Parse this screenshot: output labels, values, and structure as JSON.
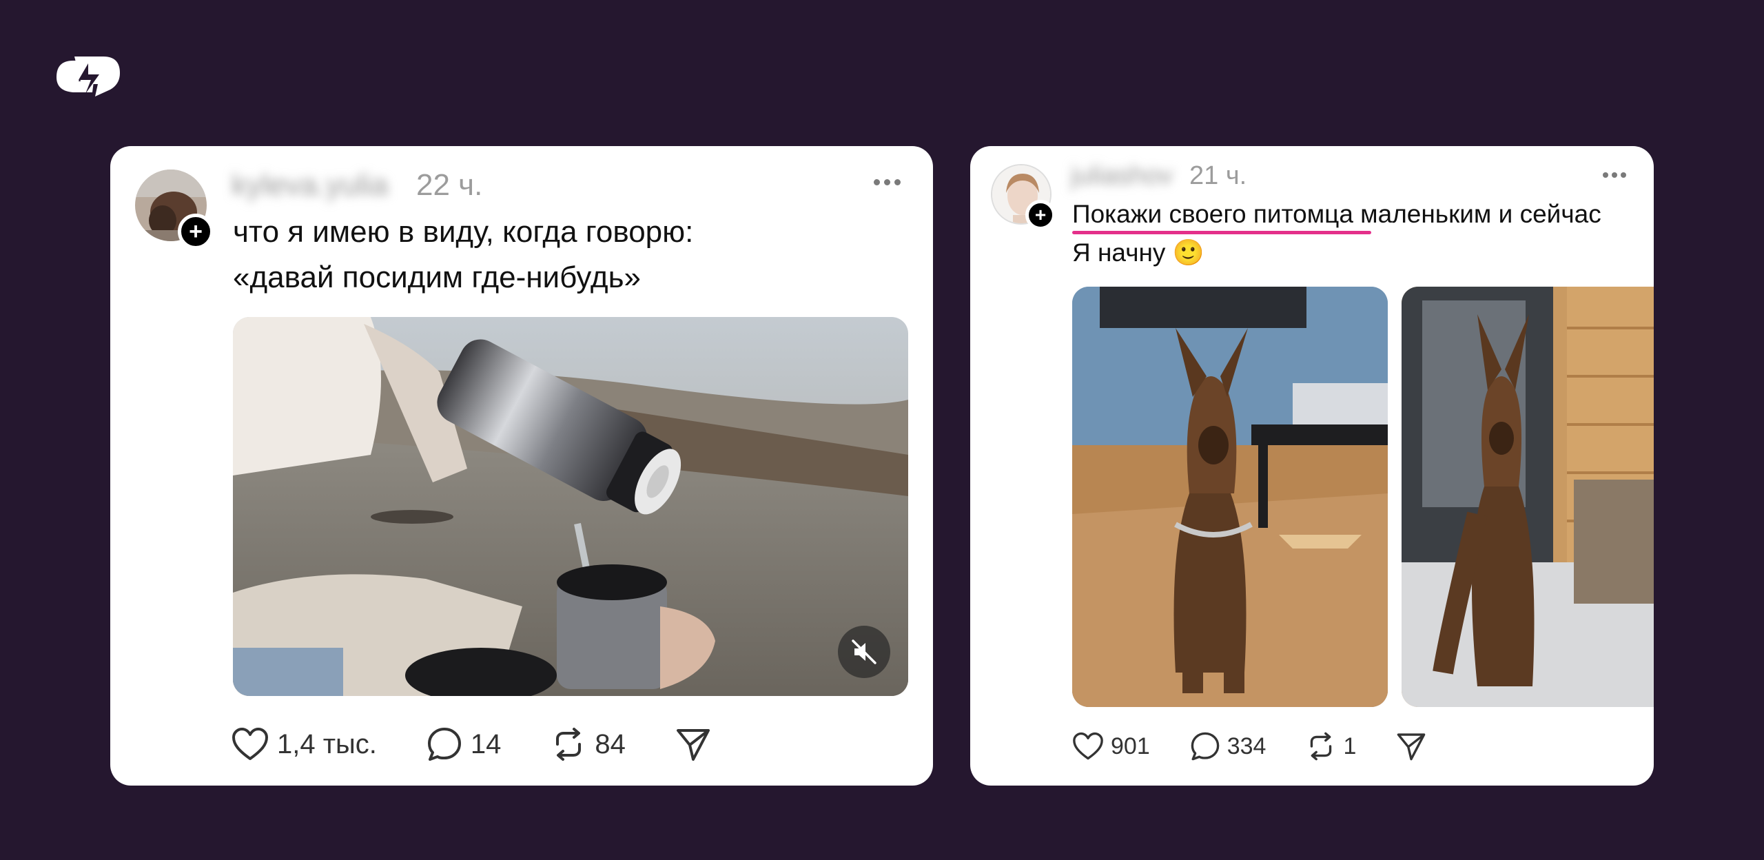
{
  "brand": {
    "logo_icon": "threads-like-logo-icon",
    "accent": "#e4308a",
    "background": "#25172f"
  },
  "posts": [
    {
      "username": "kyleva.yulia",
      "time": "22 ч.",
      "text_lines": [
        "что я имею в виду, когда говорю:",
        "«давай посидим где-нибудь»"
      ],
      "media_type": "video",
      "media_description_icon": "mute-icon",
      "stats": {
        "likes": "1,4 тыс.",
        "comments": "14",
        "reposts": "84"
      }
    },
    {
      "username": "juliashov",
      "time": "21 ч.",
      "text_lines": [
        "Покажи своего питомца маленьким и сейчас",
        "Я начну 🙂"
      ],
      "media_type": "photos",
      "stats": {
        "likes": "901",
        "comments": "334",
        "reposts": "1"
      }
    }
  ]
}
